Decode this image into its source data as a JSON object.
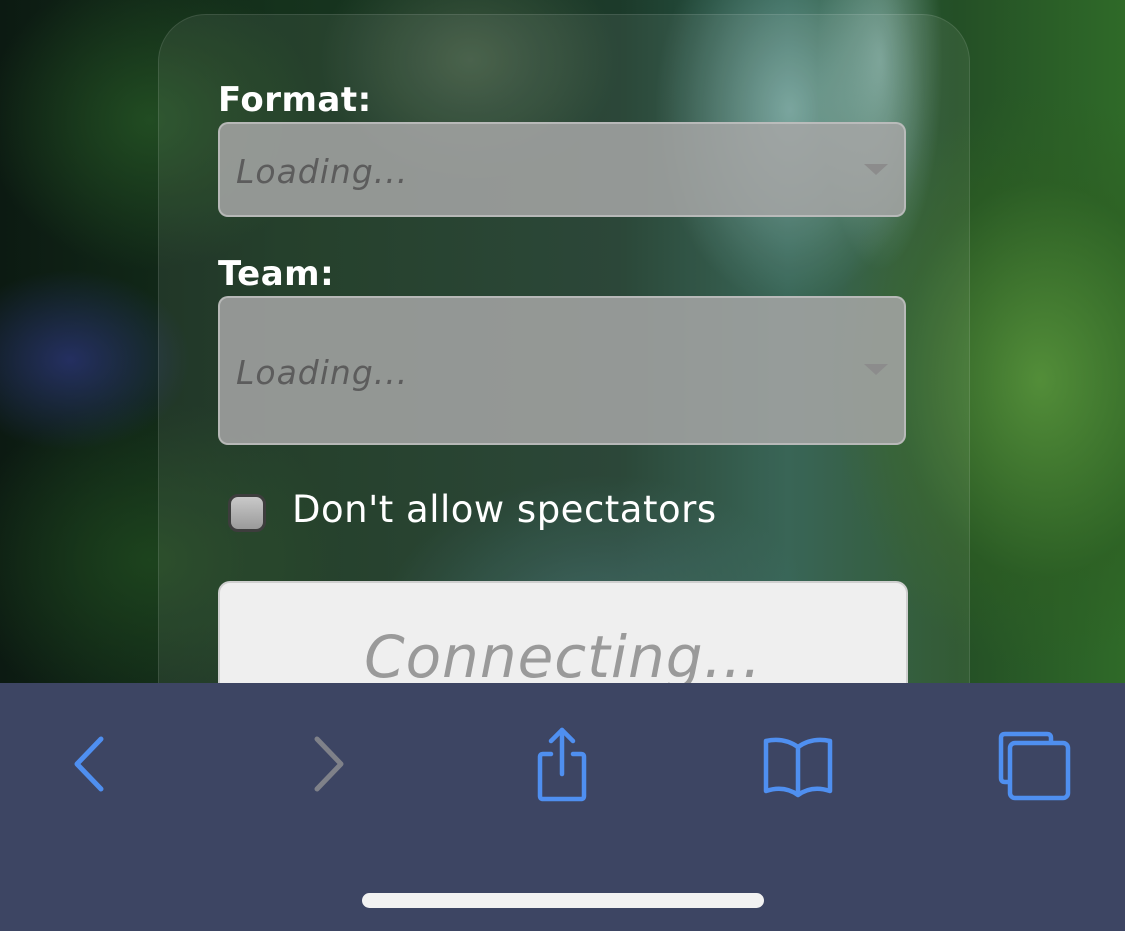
{
  "form": {
    "format_label": "Format:",
    "format_value": "Loading...",
    "team_label": "Team:",
    "team_value": "Loading...",
    "spectators_label": "Don't allow spectators",
    "spectators_checked": false,
    "connect_button_label": "Connecting..."
  },
  "toolbar": {
    "items": [
      {
        "name": "back",
        "icon": "chevron-left-icon",
        "enabled": true
      },
      {
        "name": "forward",
        "icon": "chevron-right-icon",
        "enabled": false
      },
      {
        "name": "share",
        "icon": "share-icon",
        "enabled": true
      },
      {
        "name": "bookmarks",
        "icon": "book-icon",
        "enabled": true
      },
      {
        "name": "tabs",
        "icon": "tabs-icon",
        "enabled": true
      }
    ],
    "colors": {
      "background": "#3d4563",
      "accent": "#4f8ff0",
      "disabled": "#7f8189"
    }
  }
}
